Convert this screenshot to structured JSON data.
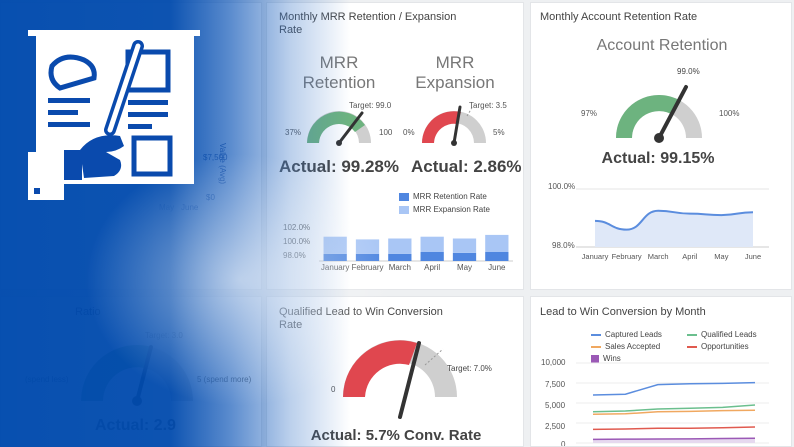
{
  "panels": {
    "mrr": {
      "title_line1": "Monthly MRR Retention / Expansion",
      "title_line2": "Rate",
      "retention": {
        "heading_line1": "MRR",
        "heading_line2": "Retention",
        "target": "Target: 99.0",
        "min": "37%",
        "max": "100",
        "actual": "Actual: 99.28%"
      },
      "expansion": {
        "heading_line1": "MRR",
        "heading_line2": "Expansion",
        "target": "Target: 3.5",
        "min": "0%",
        "max": "5%",
        "actual": "Actual: 2.86%"
      },
      "legend": [
        "MRR Retention Rate",
        "MRR Expansion Rate"
      ],
      "yticks": [
        "102.0%",
        "100.0%",
        "98.0%"
      ]
    },
    "account": {
      "title": "Monthly Account Retention Rate",
      "heading": "Account Retention",
      "target": "99.0%",
      "min": "97%",
      "max": "100%",
      "actual": "Actual: 99.15%",
      "yticks": [
        "100.0%",
        "98.0%"
      ]
    },
    "ratio": {
      "title": "Ratio",
      "target": "Target: 3.0",
      "left_label": "(spend less)",
      "right_label": "5 (spend more)",
      "actual": "Actual: 2.9"
    },
    "qualified": {
      "title_line1": "Qualified Lead to Win Conversion",
      "title_line2": "Rate",
      "target": "Target: 7.0%",
      "min": "0",
      "actual": "Actual: 5.7% Conv. Rate"
    },
    "lead": {
      "title": "Lead to Win Conversion by Month",
      "legend": [
        "Captured Leads",
        "Qualified Leads",
        "Sales Accepted",
        "Opportunities",
        "Wins"
      ],
      "yticks": [
        "10,000",
        "7,500",
        "5,000",
        "2,500",
        "0"
      ]
    },
    "bg_value": {
      "axis_label": "Value (Avg)",
      "tick_7500": "$7,500",
      "tick_0": "$0",
      "months": [
        "May",
        "June"
      ]
    }
  },
  "months": [
    "January",
    "February",
    "March",
    "April",
    "May",
    "June"
  ],
  "chart_data": [
    {
      "type": "bar",
      "categories": [
        "January",
        "February",
        "March",
        "April",
        "May",
        "June"
      ],
      "series": [
        {
          "name": "MRR Retention Rate",
          "values": [
            98.8,
            98.8,
            98.8,
            99.0,
            98.9,
            99.0
          ]
        },
        {
          "name": "MRR Expansion Rate",
          "values": [
            1.9,
            1.6,
            1.7,
            1.7,
            1.6,
            1.9
          ]
        }
      ],
      "stacked": true,
      "ylim": [
        98.0,
        102.0
      ],
      "legend": "top",
      "colors": [
        "#4f86e0",
        "#a9c6f5"
      ]
    },
    {
      "type": "area",
      "x": [
        "January",
        "February",
        "March",
        "April",
        "May",
        "June"
      ],
      "series": [
        {
          "values": [
            98.9,
            98.6,
            99.25,
            99.15,
            99.1,
            99.2
          ]
        }
      ],
      "ylim": [
        98.0,
        100.0
      ],
      "colors": [
        "#5b8dde"
      ]
    },
    {
      "type": "line",
      "x": [
        "January",
        "February",
        "March",
        "April",
        "May",
        "June"
      ],
      "series": [
        {
          "name": "Captured Leads",
          "values": [
            6000,
            6100,
            7300,
            7400,
            7450,
            7550
          ]
        },
        {
          "name": "Qualified Leads",
          "values": [
            3900,
            4000,
            4250,
            4350,
            4450,
            4750
          ]
        },
        {
          "name": "Sales Accepted",
          "values": [
            3600,
            3650,
            3900,
            3950,
            4050,
            4100
          ]
        },
        {
          "name": "Opportunities",
          "values": [
            1700,
            1750,
            1850,
            1850,
            1900,
            2000
          ]
        },
        {
          "name": "Wins",
          "values": [
            450,
            480,
            500,
            520,
            560,
            600
          ]
        }
      ],
      "ylim": [
        0,
        10000
      ],
      "legend": "top",
      "colors": [
        "#5b8dde",
        "#6bbf8e",
        "#f0a860",
        "#e05a4f",
        "#9b59b6"
      ]
    }
  ],
  "gauges": {
    "mrr_retention": {
      "min": 37,
      "max": 100,
      "target": 99.0,
      "actual": 99.28
    },
    "mrr_expansion": {
      "min": 0,
      "max": 5,
      "target": 3.5,
      "actual": 2.86
    },
    "account": {
      "min": 97,
      "max": 100,
      "target": 99.0,
      "actual": 99.15
    },
    "ratio": {
      "min": 0,
      "max": 5,
      "target": 3.0,
      "actual": 2.9
    },
    "qualified": {
      "min": 0,
      "max": 10,
      "target": 7.0,
      "actual": 5.7
    }
  },
  "colors": {
    "green": "#6db37f",
    "red": "#e0474f",
    "grey": "#cfcfcf",
    "brand_blue": "#0a4aad",
    "needle": "#333333"
  }
}
